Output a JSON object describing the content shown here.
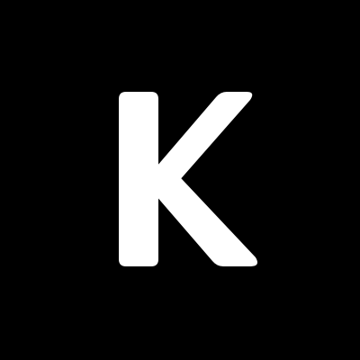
{
  "logo": {
    "letter": "K",
    "background_color": "#000000",
    "foreground_color": "#FFFFFF"
  }
}
